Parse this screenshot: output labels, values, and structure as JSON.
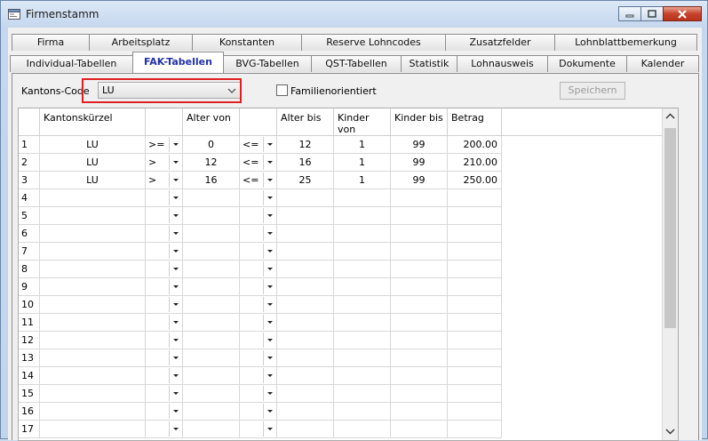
{
  "window": {
    "title": "Firmenstamm"
  },
  "tabs_row1": [
    "Firma",
    "Arbeitsplatz",
    "Konstanten",
    "Reserve Lohncodes",
    "Zusatzfelder",
    "Lohnblattbemerkung"
  ],
  "tabs_row2": [
    "Individual-Tabellen",
    "FAK-Tabellen",
    "BVG-Tabellen",
    "QST-Tabellen",
    "Statistik",
    "Lohnausweis",
    "Dokumente",
    "Kalender"
  ],
  "active_tab": "FAK-Tabellen",
  "form": {
    "kantons_label": "Kantons-Code",
    "kantons_value": "LU",
    "familien_label": "Familienorientiert",
    "familien_checked": false,
    "save_label": "Speichern"
  },
  "grid": {
    "headers": [
      "Kantonskürzel",
      "",
      "Alter von",
      "",
      "Alter bis",
      "Kinder von",
      "Kinder bis",
      "Betrag"
    ],
    "rows": [
      {
        "n": "1",
        "k": "LU",
        "op1": ">=",
        "von": "0",
        "op2": "<=",
        "bis": "12",
        "kvon": "1",
        "kbis": "99",
        "betrag": "200.00"
      },
      {
        "n": "2",
        "k": "LU",
        "op1": ">",
        "von": "12",
        "op2": "<=",
        "bis": "16",
        "kvon": "1",
        "kbis": "99",
        "betrag": "210.00"
      },
      {
        "n": "3",
        "k": "LU",
        "op1": ">",
        "von": "16",
        "op2": "<=",
        "bis": "25",
        "kvon": "1",
        "kbis": "99",
        "betrag": "250.00"
      },
      {
        "n": "4"
      },
      {
        "n": "5"
      },
      {
        "n": "6"
      },
      {
        "n": "7"
      },
      {
        "n": "8"
      },
      {
        "n": "9"
      },
      {
        "n": "10"
      },
      {
        "n": "11"
      },
      {
        "n": "12"
      },
      {
        "n": "13"
      },
      {
        "n": "14"
      },
      {
        "n": "15"
      },
      {
        "n": "16"
      },
      {
        "n": "17"
      }
    ]
  },
  "colors": {
    "highlight": "#e02020",
    "active_tab_text": "#2233aa"
  }
}
